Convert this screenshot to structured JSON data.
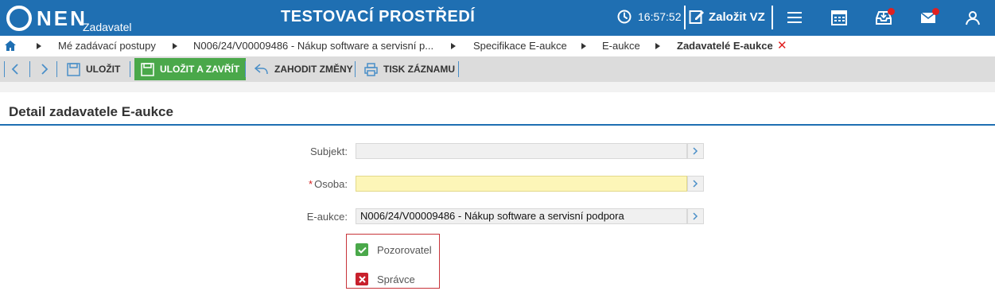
{
  "header": {
    "logo_text": "NEN",
    "logo_sub": "Zadavatel",
    "env_title": "TESTOVACÍ PROSTŘEDÍ",
    "time": "16:57:52",
    "new_vz_label": "Založit VZ"
  },
  "breadcrumb": {
    "items": [
      "Mé zadávací postupy",
      "N006/24/V00009486 - Nákup software a servisní p...",
      "Specifikace E-aukce",
      "E-aukce",
      "Zadavatelé E-aukce"
    ]
  },
  "toolbar": {
    "save_label": "ULOŽIT",
    "save_close_label": "ULOŽIT A ZAVŘÍT",
    "discard_label": "ZAHODIT ZMĚNY",
    "print_label": "TISK ZÁZNAMU"
  },
  "section": {
    "title": "Detail zadavatele E-aukce"
  },
  "form": {
    "subject_label": "Subjekt:",
    "subject_value": "",
    "person_required": "*",
    "person_label": "Osoba:",
    "person_value": "",
    "eauction_label": "E-aukce:",
    "eauction_value": "N006/24/V00009486 - Nákup software a servisní podpora"
  },
  "roles": {
    "observer_label": "Pozorovatel",
    "observer_checked": true,
    "admin_label": "Správce",
    "admin_checked": false
  },
  "colors": {
    "brand": "#1f6fb2",
    "save_close_green": "#4aa84a",
    "notification_red": "#e02020"
  }
}
